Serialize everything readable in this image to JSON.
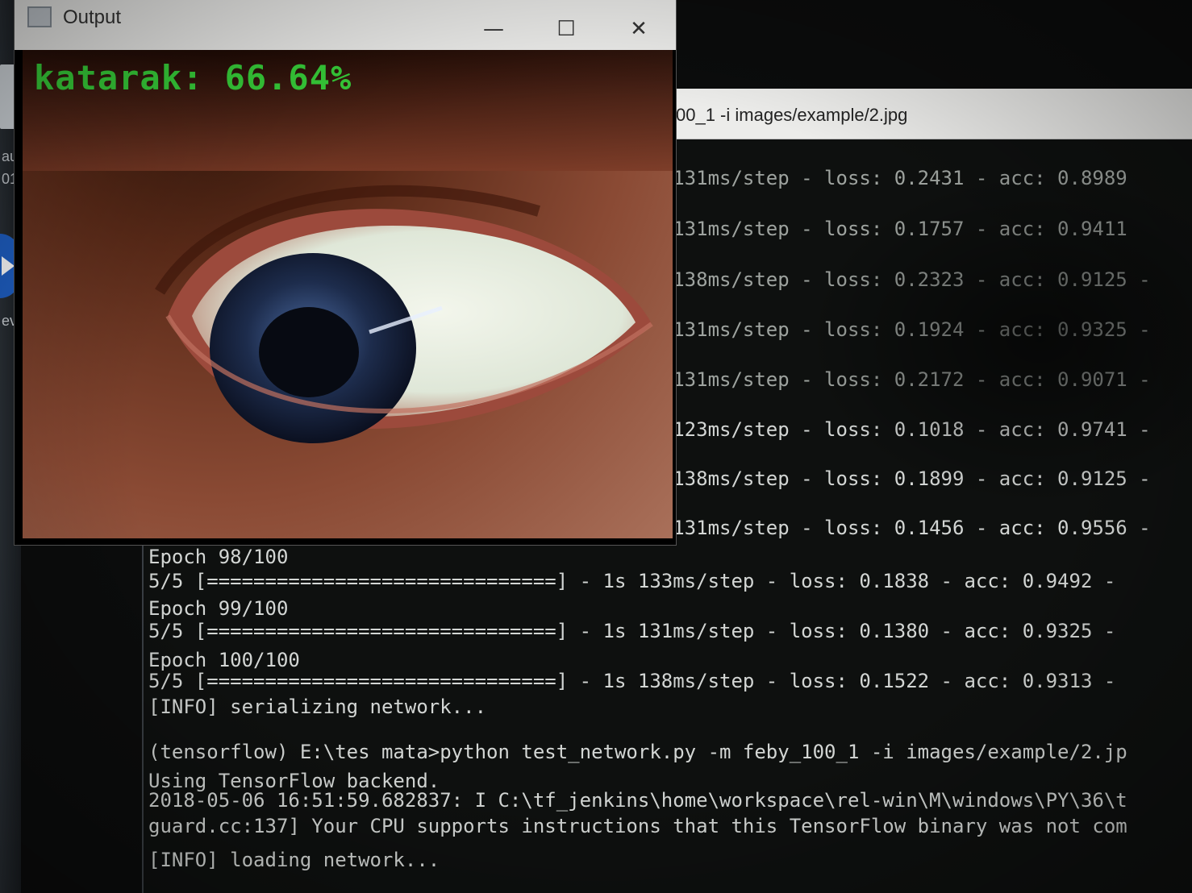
{
  "output_window": {
    "title": "Output",
    "buttons": {
      "minimize": "—",
      "maximize": "☐",
      "close": "✕"
    },
    "prediction_label": "katarak: 66.64%"
  },
  "terminal": {
    "title": "00_1 -i images/example/2.jpg",
    "lines": [
      "                                             131ms/step - loss: 0.2431 - acc: 0.8989",
      "                                             131ms/step - loss: 0.1757 - acc: 0.9411",
      "                                             138ms/step - loss: 0.2323 - acc: 0.9125 -",
      "                                             131ms/step - loss: 0.1924 - acc: 0.9325 -",
      "                                             131ms/step - loss: 0.2172 - acc: 0.9071 -",
      "                                             123ms/step - loss: 0.1018 - acc: 0.9741 -",
      "                                             138ms/step - loss: 0.1899 - acc: 0.9125 -",
      "                                             131ms/step - loss: 0.1456 - acc: 0.9556 -",
      "Epoch 98/100",
      "5/5 [==============================] - 1s 133ms/step - loss: 0.1838 - acc: 0.9492 -",
      "Epoch 99/100",
      "5/5 [==============================] - 1s 131ms/step - loss: 0.1380 - acc: 0.9325 -",
      "Epoch 100/100",
      "5/5 [==============================] - 1s 138ms/step - loss: 0.1522 - acc: 0.9313 -",
      "[INFO] serializing network...",
      "",
      "(tensorflow) E:\\tes mata>python test_network.py -m feby_100_1 -i images/example/2.jp",
      "Using TensorFlow backend.",
      "2018-05-06 16:51:59.682837: I C:\\tf_jenkins\\home\\workspace\\rel-win\\M\\windows\\PY\\36\\t",
      "guard.cc:137] Your CPU supports instructions that this TensorFlow binary was not com",
      "[INFO] loading network..."
    ]
  },
  "desktop": {
    "strip_labels": [
      "au",
      "01",
      "ev"
    ]
  }
}
